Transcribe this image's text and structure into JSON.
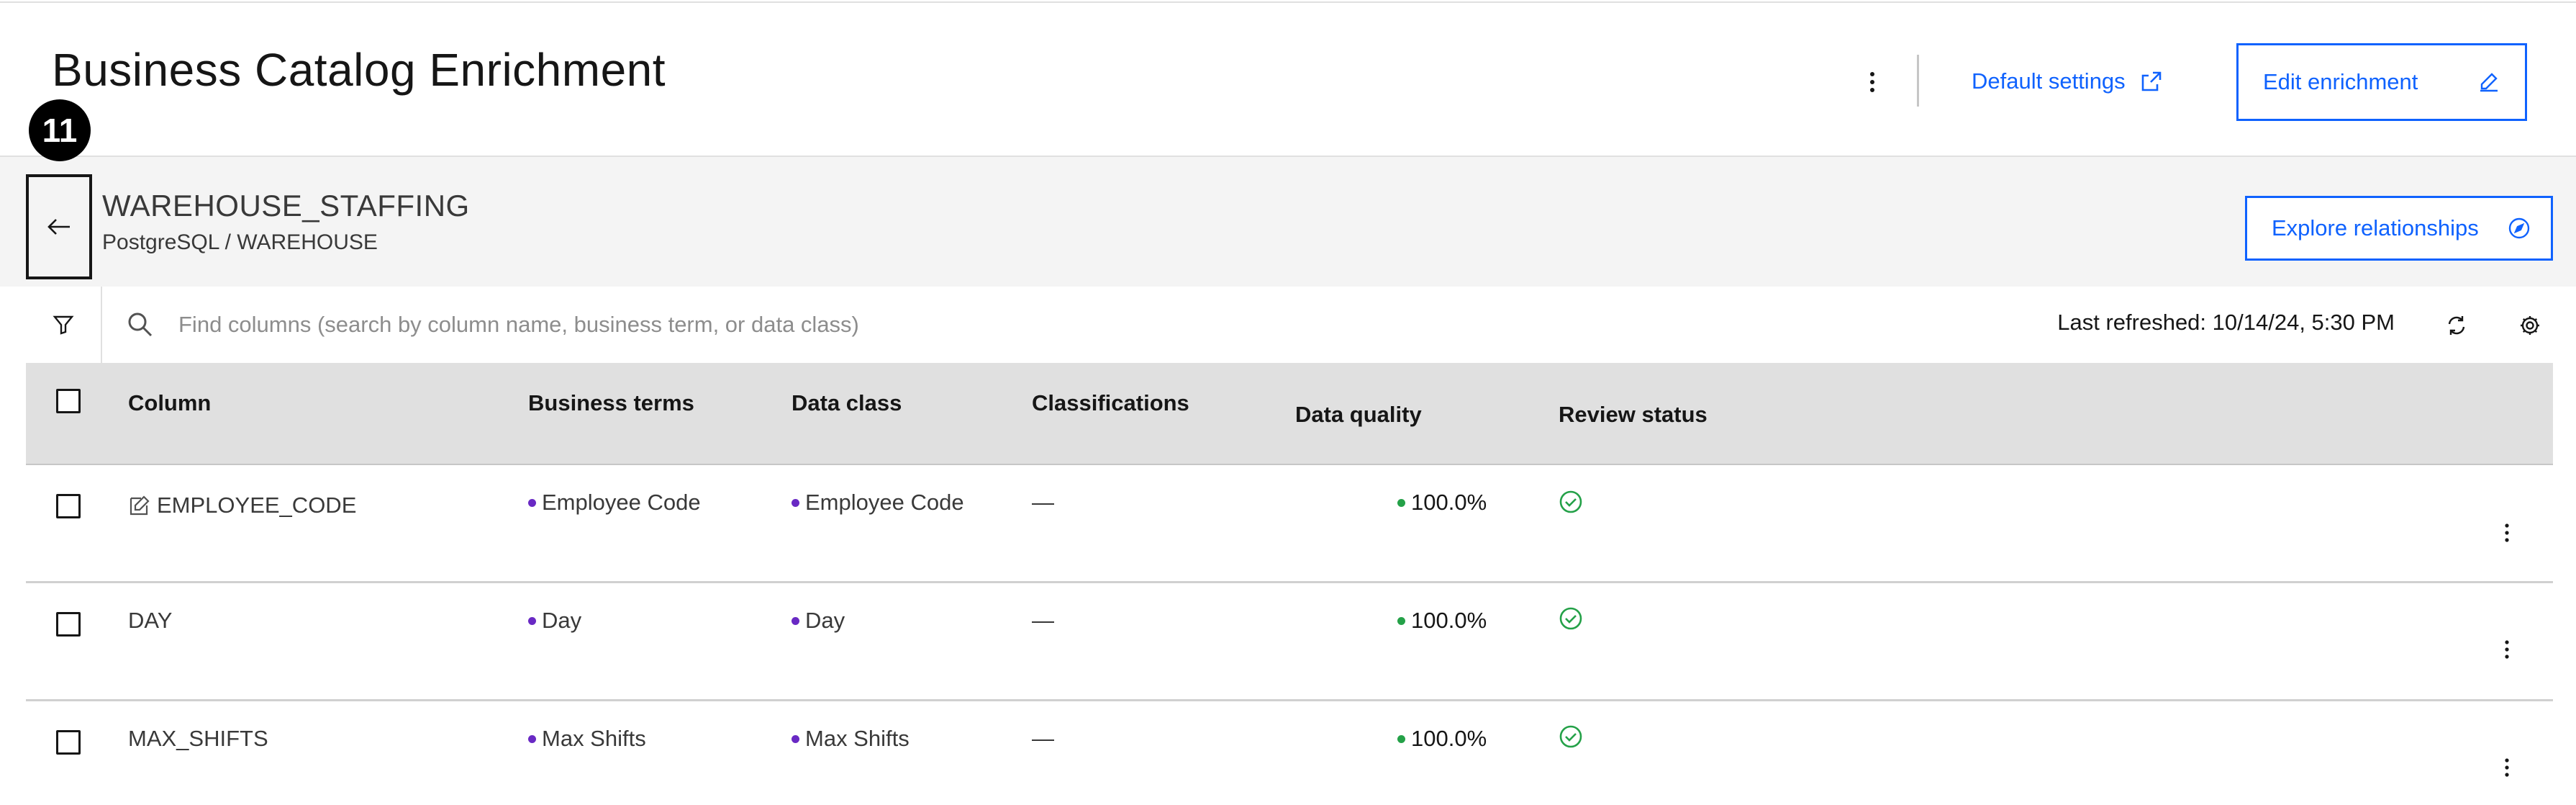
{
  "header": {
    "title": "Business Catalog Enrichment",
    "default_settings_label": "Default settings",
    "edit_enrichment_label": "Edit enrichment"
  },
  "step_badge": "11",
  "asset": {
    "name": "WAREHOUSE_STAFFING",
    "path": "PostgreSQL / WAREHOUSE",
    "explore_label": "Explore relationships"
  },
  "toolbar": {
    "search_placeholder": "Find columns (search by column name, business term, or data class)",
    "last_refreshed": "Last refreshed: 10/14/24, 5:30 PM"
  },
  "table": {
    "headers": {
      "column": "Column",
      "business_terms": "Business terms",
      "data_class": "Data class",
      "classifications": "Classifications",
      "data_quality": "Data quality",
      "review_status": "Review status"
    },
    "rows": [
      {
        "column": "EMPLOYEE_CODE",
        "business_term": "Employee Code",
        "data_class": "Employee Code",
        "classification": "—",
        "data_quality": "100.0%",
        "review_status": "reviewed",
        "edited": true
      },
      {
        "column": "DAY",
        "business_term": "Day",
        "data_class": "Day",
        "classification": "—",
        "data_quality": "100.0%",
        "review_status": "reviewed",
        "edited": false
      },
      {
        "column": "MAX_SHIFTS",
        "business_term": "Max Shifts",
        "data_class": "Max Shifts",
        "classification": "—",
        "data_quality": "100.0%",
        "review_status": "reviewed",
        "edited": false
      }
    ]
  },
  "colors": {
    "accent": "#0f62fe",
    "term_dot": "#6929c4",
    "quality_dot": "#24a148",
    "review_ok": "#24a148"
  }
}
